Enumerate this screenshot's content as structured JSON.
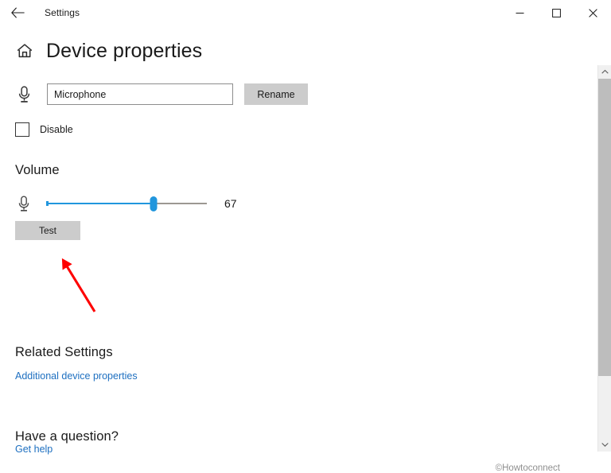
{
  "window": {
    "title": "Settings",
    "back_label": "Back",
    "minimize_label": "Minimize",
    "maximize_label": "Maximize",
    "close_label": "Close"
  },
  "page": {
    "title": "Device properties",
    "home_label": "Home"
  },
  "device": {
    "icon": "microphone-icon",
    "name_value": "Microphone",
    "name_placeholder": "Microphone",
    "rename_label": "Rename",
    "disable_label": "Disable",
    "disable_checked": false
  },
  "volume": {
    "heading": "Volume",
    "icon": "microphone-icon",
    "value": 67,
    "min": 0,
    "max": 100,
    "display_value": "67",
    "test_label": "Test"
  },
  "related_settings": {
    "heading": "Related Settings",
    "links": [
      {
        "label": "Additional device properties"
      }
    ]
  },
  "help": {
    "heading": "Have a question?",
    "links": [
      {
        "label": "Get help"
      }
    ]
  },
  "watermark": {
    "text": "©Howtoconnect"
  },
  "scrollbar": {
    "up_label": "Scroll up",
    "down_label": "Scroll down"
  },
  "colors": {
    "accent": "#2196dd",
    "link": "#1d6fc0",
    "button_bg": "#cccccc",
    "annotation": "#fe0000",
    "track": "#9c9892"
  }
}
